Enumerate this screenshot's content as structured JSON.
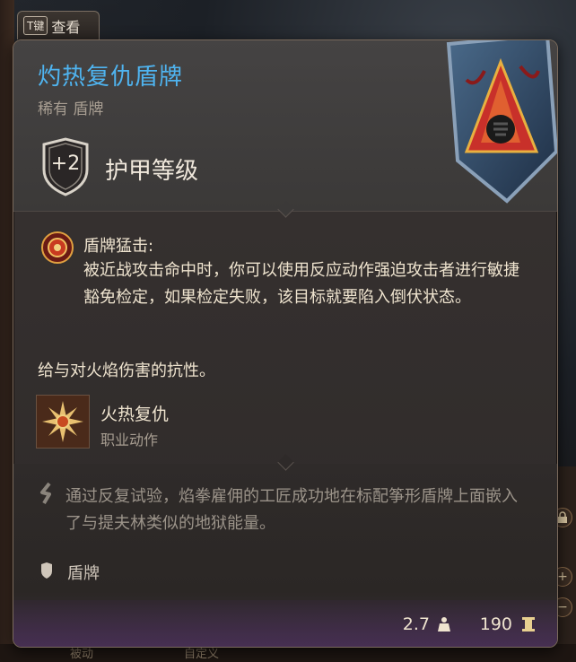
{
  "key_hint": {
    "key": "T键",
    "label": "查看"
  },
  "item": {
    "name": "灼热复仇盾牌",
    "rarity_type": "稀有 盾牌",
    "armor_class": {
      "value": "+2",
      "label": "护甲等级"
    },
    "ability": {
      "title": "盾牌猛击:",
      "description": "被近战攻击命中时，你可以使用反应动作强迫攻击者进行敏捷豁免检定，如果检定失败，该目标就要陷入倒伏状态。"
    },
    "resistance": "给与对火焰伤害的抗性。",
    "action": {
      "name": "火热复仇",
      "type": "职业动作"
    },
    "lore": "通过反复试验，焰拳雇佣的工匠成功地在标配筝形盾牌上面嵌入了与提夫林类似的地狱能量。",
    "category": "盾牌",
    "weight": "2.7",
    "price": "190"
  },
  "background": {
    "side_buttons": [
      "",
      "+",
      "−"
    ],
    "bottom_tabs": [
      "被动",
      "自定义"
    ]
  },
  "colors": {
    "title": "#4fb4f0",
    "text": "#efe4cf",
    "muted": "#a89e92",
    "lore": "#9c948a"
  }
}
